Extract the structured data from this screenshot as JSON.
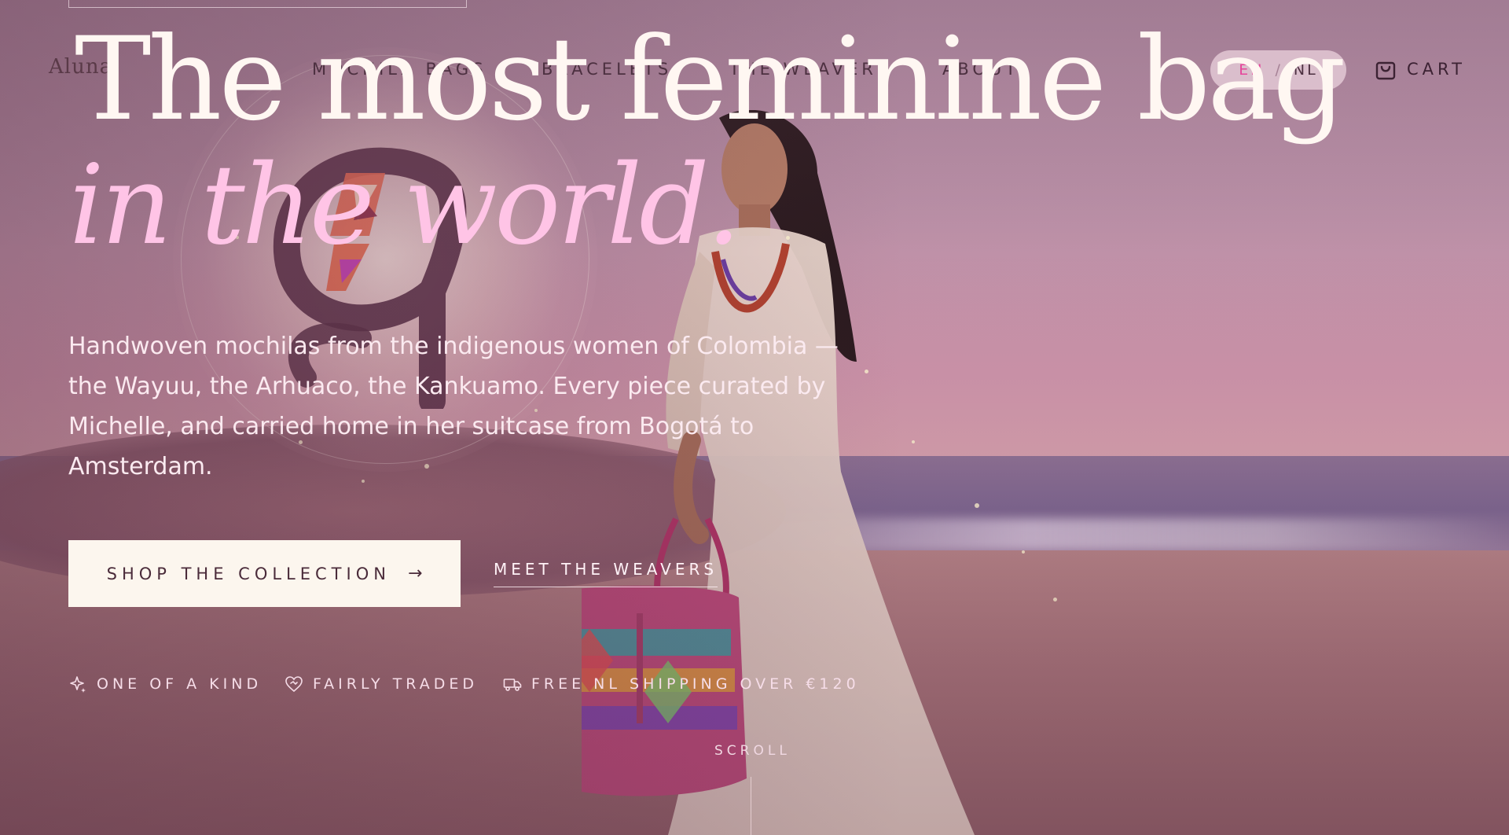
{
  "brand": {
    "name": "Aluna"
  },
  "nav": {
    "items": [
      {
        "label": "MOCHILA BAGS"
      },
      {
        "label": "BRACELETS"
      },
      {
        "label": "THE WEAVERS"
      },
      {
        "label": "ABOUT"
      }
    ]
  },
  "language": {
    "active": "EN",
    "separator": "/",
    "other": "NL"
  },
  "cart": {
    "label": "CART",
    "icon": "shopping-bag-icon"
  },
  "hero": {
    "headline_line1": "The most feminine bag",
    "headline_line2": "in the world.",
    "lede": "Handwoven mochilas from the indigenous women of Colombia — the Wayuu, the Arhuaco, the Kankuamo. Every piece curated by Michelle, and carried home in her suitcase from Bogotá to Amsterdam.",
    "cta_primary": "SHOP THE COLLECTION",
    "cta_primary_arrow": "→",
    "cta_secondary": "MEET THE WEAVERS"
  },
  "badges": [
    {
      "label": "ONE OF A KIND",
      "icon": "sparkle-icon"
    },
    {
      "label": "FAIRLY TRADED",
      "icon": "heart-handshake-icon"
    },
    {
      "label": "FREE NL SHIPPING OVER €120",
      "icon": "truck-icon"
    }
  ],
  "scroll": {
    "label": "SCROLL"
  },
  "colors": {
    "accent_pink": "#e6459a",
    "headline_cream": "#fff7f2",
    "headline_pink": "#ffc4e6",
    "button_bg": "#fcf6ee"
  }
}
